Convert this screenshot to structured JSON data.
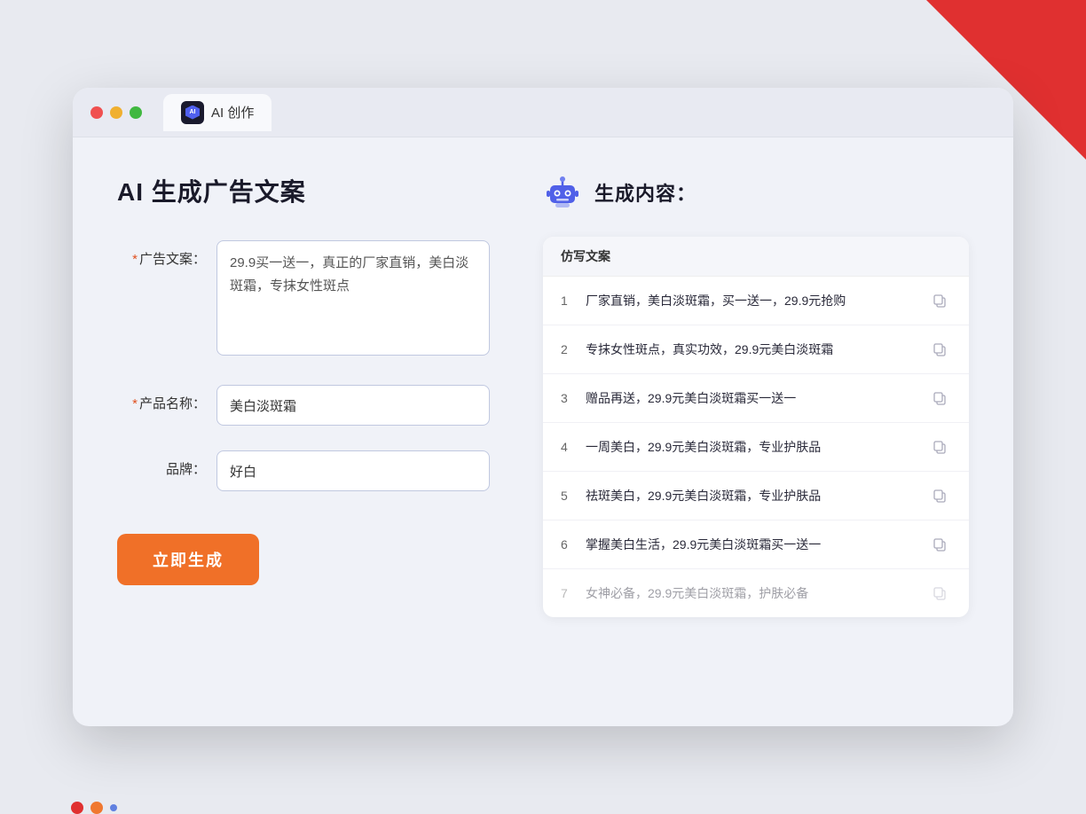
{
  "window": {
    "tab_label": "AI 创作"
  },
  "page": {
    "title": "AI 生成广告文案"
  },
  "form": {
    "ad_copy_label": "广告文案：",
    "ad_copy_required": "*",
    "ad_copy_value": "29.9买一送一，真正的厂家直销，美白淡斑霜，专抹女性斑点",
    "product_label": "产品名称：",
    "product_required": "*",
    "product_value": "美白淡斑霜",
    "brand_label": "品牌：",
    "brand_value": "好白",
    "generate_btn": "立即生成"
  },
  "result": {
    "header": "生成内容：",
    "column_label": "仿写文案",
    "items": [
      {
        "num": "1",
        "text": "厂家直销，美白淡斑霜，买一送一，29.9元抢购"
      },
      {
        "num": "2",
        "text": "专抹女性斑点，真实功效，29.9元美白淡斑霜"
      },
      {
        "num": "3",
        "text": "赠品再送，29.9元美白淡斑霜买一送一"
      },
      {
        "num": "4",
        "text": "一周美白，29.9元美白淡斑霜，专业护肤品"
      },
      {
        "num": "5",
        "text": "祛斑美白，29.9元美白淡斑霜，专业护肤品"
      },
      {
        "num": "6",
        "text": "掌握美白生活，29.9元美白淡斑霜买一送一"
      },
      {
        "num": "7",
        "text": "女神必备，29.9元美白淡斑霜，护肤必备",
        "dimmed": true
      }
    ]
  }
}
